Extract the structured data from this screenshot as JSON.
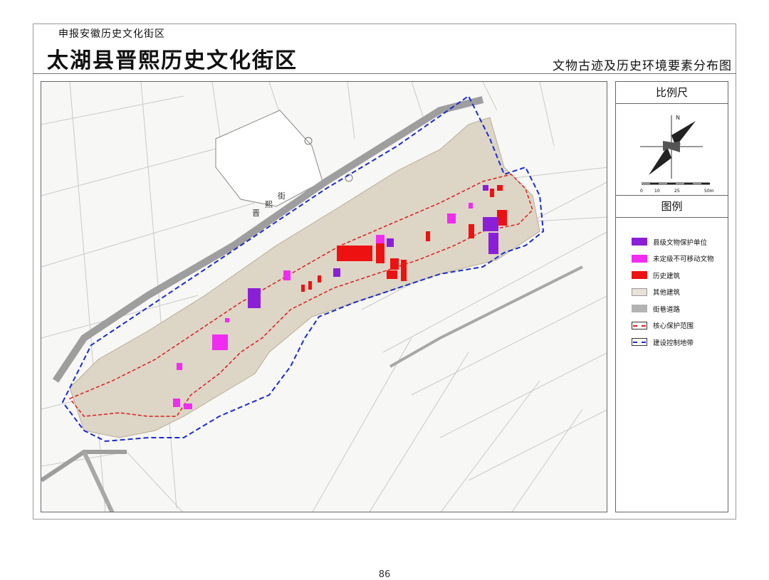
{
  "header": {
    "subtitle": "申报安徽历史文化街区",
    "title": "太湖县晋熙历史文化街区",
    "map_title": "文物古迹及历史环境要素分布图"
  },
  "panel": {
    "scale_heading": "比例尺",
    "north_label": "N",
    "scale_ticks": [
      "0",
      "10",
      "25",
      "50m"
    ],
    "legend_heading": "图例"
  },
  "legend": [
    {
      "label": "县级文物保护单位",
      "color": "#8b1fd8",
      "kind": "fill"
    },
    {
      "label": "未定级不可移动文物",
      "color": "#f02cf0",
      "kind": "fill"
    },
    {
      "label": "历史建筑",
      "color": "#ee1111",
      "kind": "fill"
    },
    {
      "label": "其他建筑",
      "color": "#e8e3d6",
      "kind": "fill"
    },
    {
      "label": "街巷道路",
      "color": "#b3b3b3",
      "kind": "fill"
    },
    {
      "label": "核心保护范围",
      "color": "#e11a1a",
      "kind": "line"
    },
    {
      "label": "建设控制地带",
      "color": "#1a2bd6",
      "kind": "line"
    }
  ],
  "map": {
    "street_labels": [
      "晋",
      "熙",
      "街"
    ]
  },
  "footer": {
    "page_number": "86"
  }
}
